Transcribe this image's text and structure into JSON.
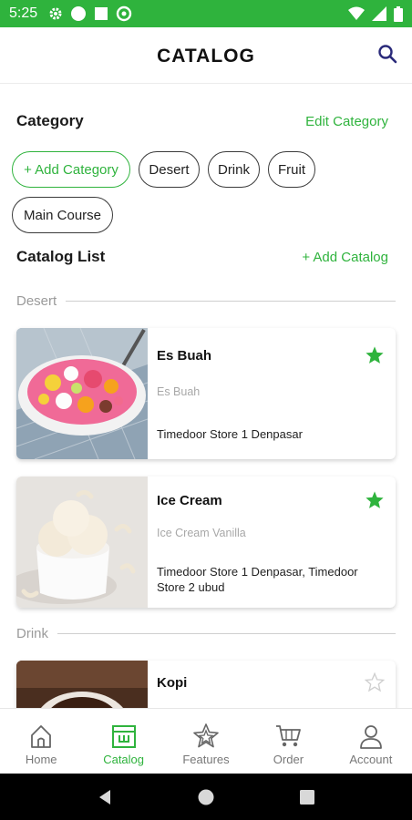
{
  "status": {
    "time": "5:25"
  },
  "app": {
    "title": "CATALOG"
  },
  "category": {
    "title": "Category",
    "edit_label": "Edit Category",
    "add_label": "+ Add Category",
    "chips": [
      "Desert",
      "Drink",
      "Fruit",
      "Main Course"
    ]
  },
  "catalog": {
    "title": "Catalog List",
    "add_label": "+ Add Catalog",
    "groups": [
      {
        "label": "Desert",
        "items": [
          {
            "name": "Es Buah",
            "description": "Es Buah",
            "store": "Timedoor Store 1 Denpasar",
            "favorite": true
          },
          {
            "name": "Ice Cream",
            "description": "Ice Cream Vanilla",
            "store": "Timedoor Store 1 Denpasar, Timedoor Store 2 ubud",
            "favorite": true
          }
        ]
      },
      {
        "label": "Drink",
        "items": [
          {
            "name": "Kopi",
            "description": "",
            "store": "",
            "favorite": false
          }
        ]
      }
    ]
  },
  "nav": {
    "items": [
      {
        "label": "Home",
        "icon": "home-icon"
      },
      {
        "label": "Catalog",
        "icon": "catalog-icon",
        "active": true
      },
      {
        "label": "Features",
        "icon": "features-icon"
      },
      {
        "label": "Order",
        "icon": "cart-icon"
      },
      {
        "label": "Account",
        "icon": "account-icon"
      }
    ]
  },
  "colors": {
    "accent": "#2fb33d",
    "star_active": "#2fb33d",
    "star_inactive": "#cfcfcf"
  }
}
